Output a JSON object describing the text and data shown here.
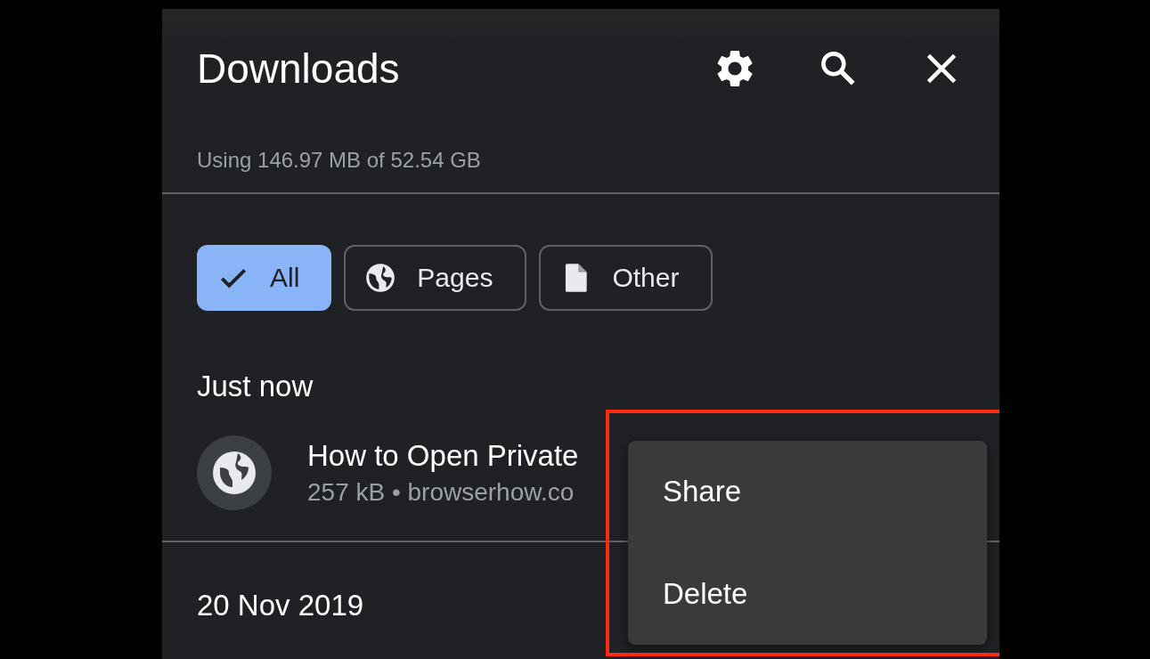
{
  "header": {
    "title": "Downloads"
  },
  "storage": "Using 146.97 MB of 52.54 GB",
  "filters": [
    {
      "label": "All",
      "kind": "check",
      "selected": true
    },
    {
      "label": "Pages",
      "kind": "globe",
      "selected": false
    },
    {
      "label": "Other",
      "kind": "file",
      "selected": false
    }
  ],
  "sections": [
    {
      "heading": "Just now",
      "items": [
        {
          "title": "How to Open Private",
          "meta": "257 kB • browserhow.co"
        }
      ]
    },
    {
      "heading": "20 Nov 2019"
    }
  ],
  "menu": [
    "Share",
    "Delete"
  ]
}
